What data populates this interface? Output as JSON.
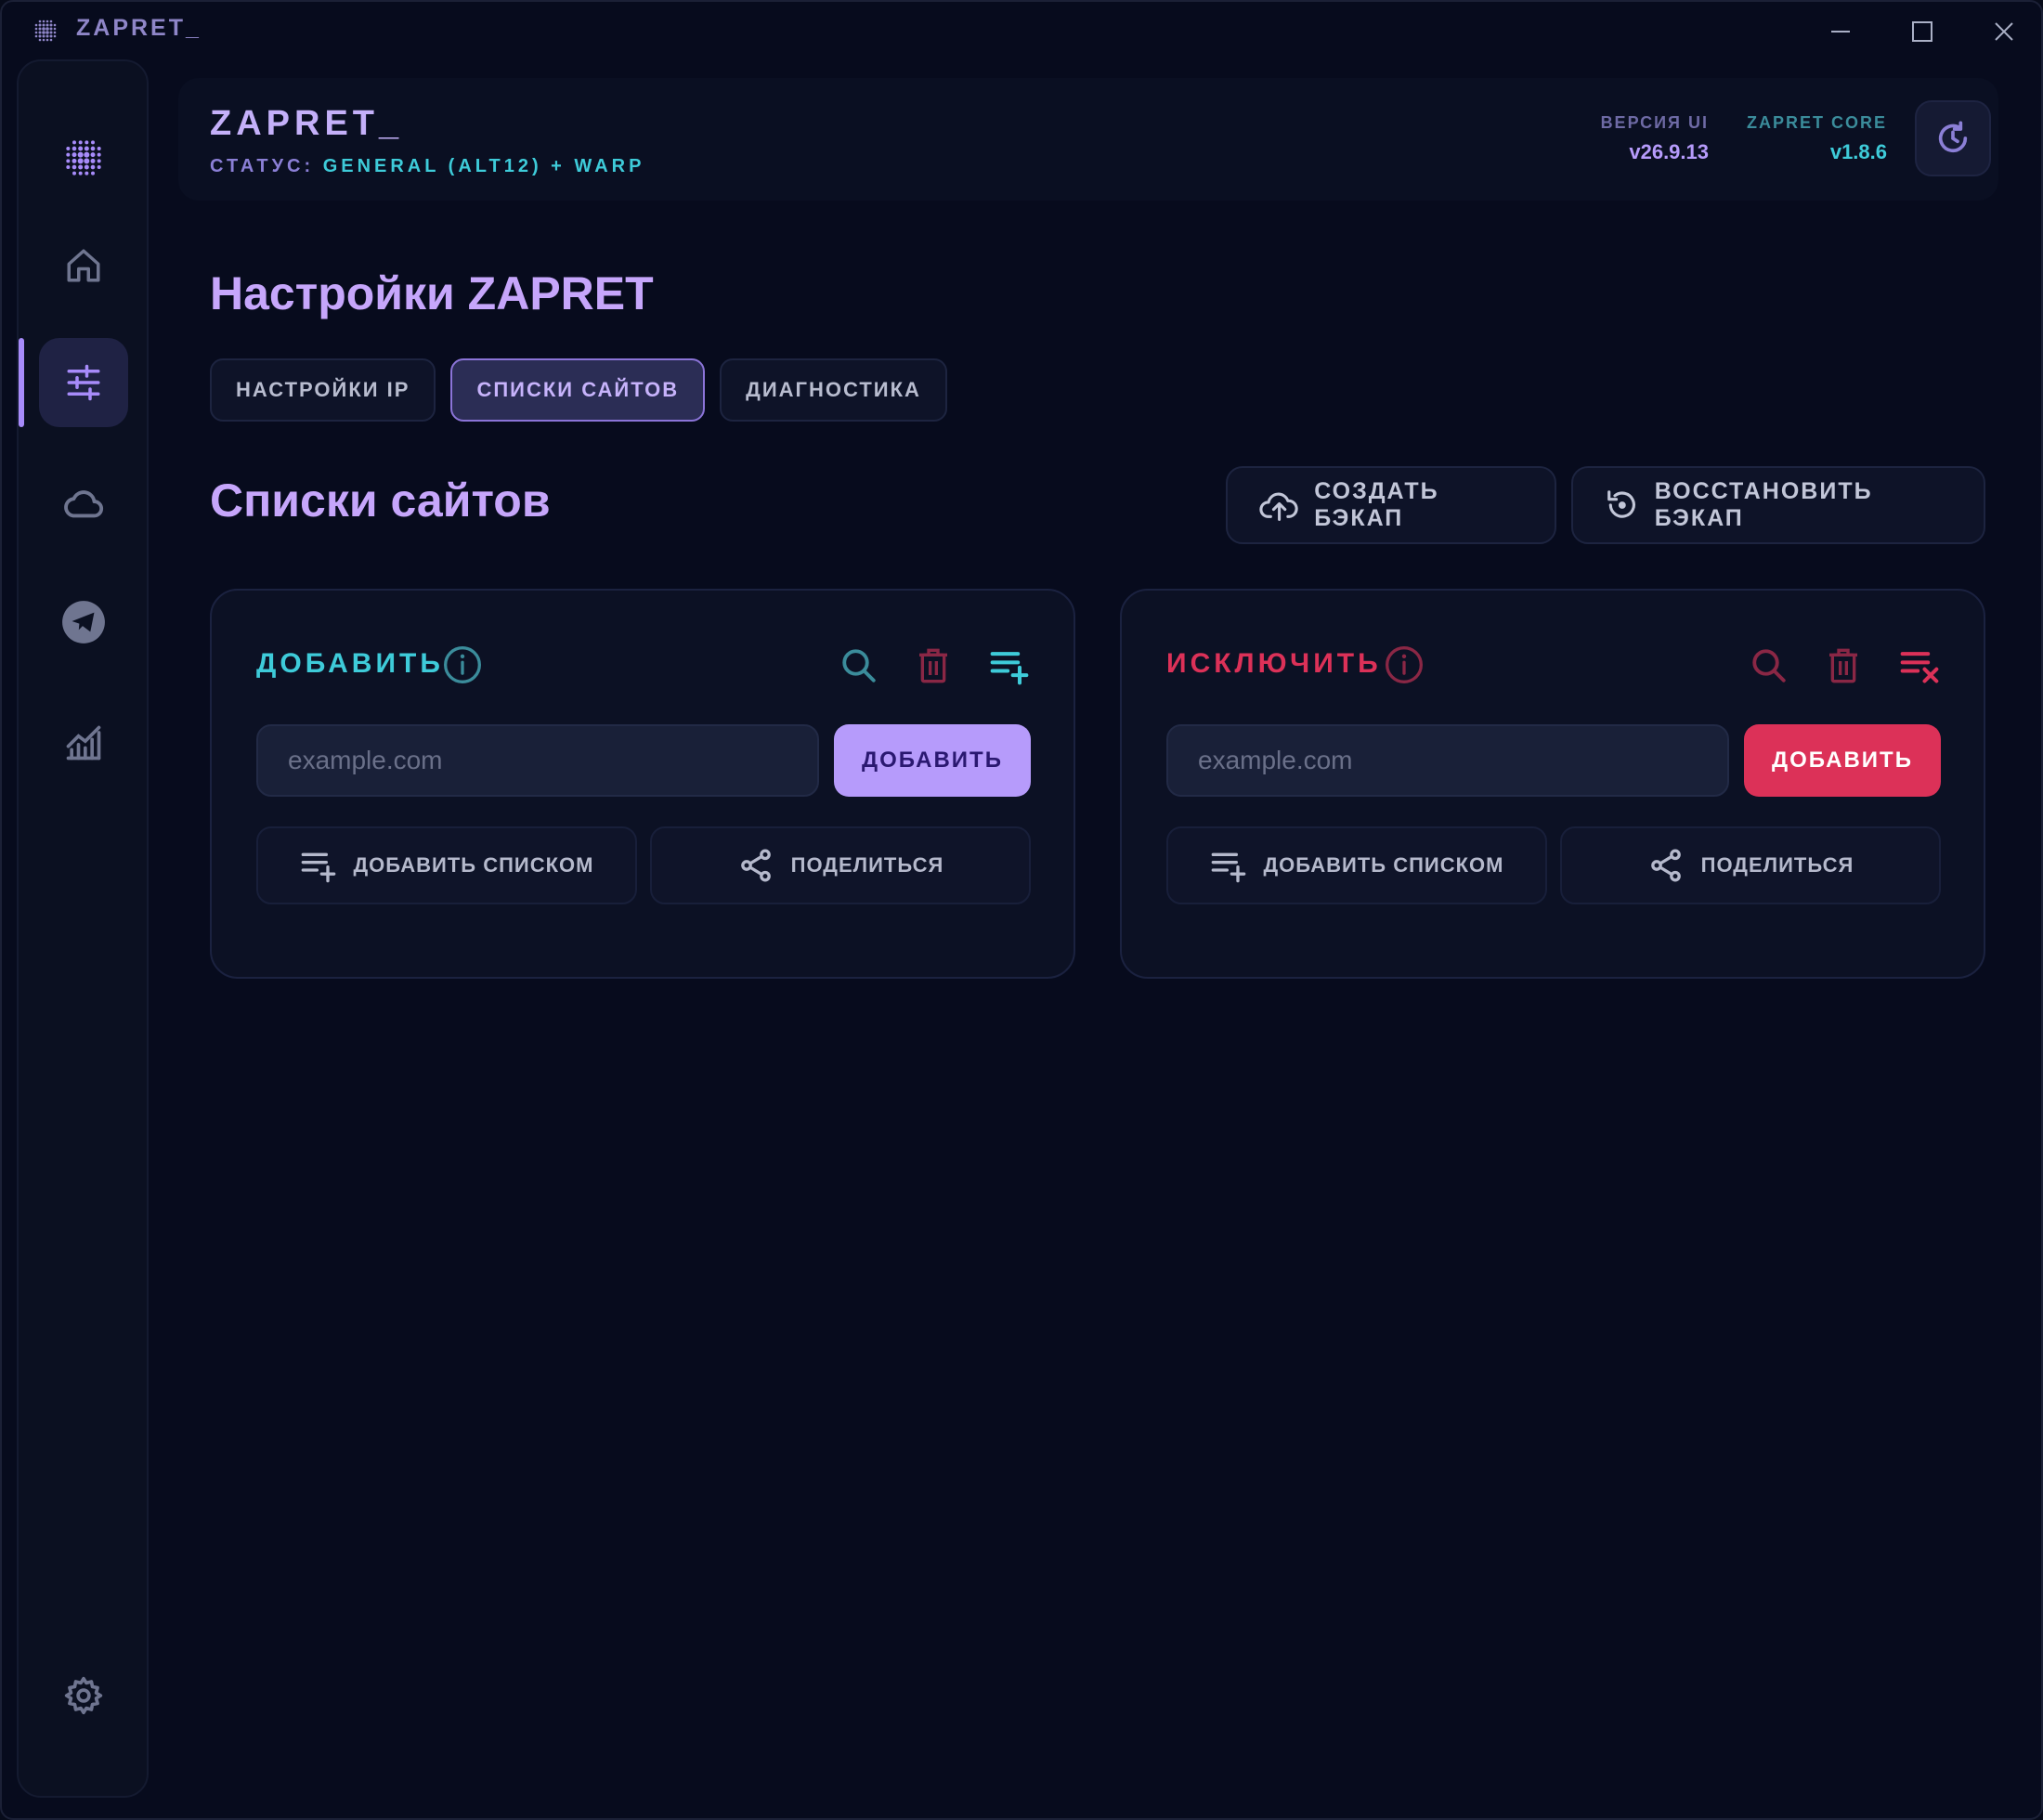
{
  "titlebar": {
    "title": "ZAPRET_",
    "minimize_icon": "minimize-icon",
    "maximize_icon": "maximize-icon",
    "close_icon": "close-icon"
  },
  "sidebar": {
    "items": [
      {
        "id": "logo",
        "icon": "dot-grid-logo-icon"
      },
      {
        "id": "home",
        "icon": "home-icon"
      },
      {
        "id": "settings-sliders",
        "icon": "sliders-icon",
        "active": true
      },
      {
        "id": "cloud",
        "icon": "cloud-icon"
      },
      {
        "id": "telegram",
        "icon": "telegram-icon"
      },
      {
        "id": "stats",
        "icon": "chart-icon"
      },
      {
        "id": "gear",
        "icon": "gear-icon"
      }
    ]
  },
  "header": {
    "app_name": "ZAPRET_",
    "status_label": "СТАТУС:",
    "status_value": "GENERAL (ALT12) + WARP",
    "ui_version_label": "ВЕРСИЯ UI",
    "ui_version_value": "v26.9.13",
    "core_version_label": "ZAPRET CORE",
    "core_version_value": "v1.8.6",
    "refresh_icon": "refresh-icon"
  },
  "page": {
    "title": "Настройки ZAPRET",
    "tabs": [
      {
        "label": "НАСТРОЙКИ IP",
        "active": false
      },
      {
        "label": "СПИСКИ САЙТОВ",
        "active": true
      },
      {
        "label": "ДИАГНОСТИКА",
        "active": false
      }
    ],
    "section_title": "Списки сайтов",
    "create_backup_label": "СОЗДАТЬ БЭКАП",
    "restore_backup_label": "ВОССТАНОВИТЬ БЭКАП"
  },
  "include_card": {
    "title": "ДОБАВИТЬ",
    "input_placeholder": "example.com",
    "input_value": "",
    "add_button_label": "ДОБАВИТЬ",
    "add_list_label": "ДОБАВИТЬ СПИСКОМ",
    "share_label": "ПОДЕЛИТЬСЯ",
    "accent_color": "#3ecbd9",
    "button_color": "#b69bfb"
  },
  "exclude_card": {
    "title": "ИСКЛЮЧИТЬ",
    "input_placeholder": "example.com",
    "input_value": "",
    "add_button_label": "ДОБАВИТЬ",
    "add_list_label": "ДОБАВИТЬ СПИСКОМ",
    "share_label": "ПОДЕЛИТЬСЯ",
    "accent_color": "#dc3158",
    "button_color": "#dc3158"
  },
  "colors": {
    "background": "#070b1d",
    "accent_purple": "#c6a6fb",
    "accent_cyan": "#3ecbd9",
    "accent_red": "#dc3158"
  }
}
